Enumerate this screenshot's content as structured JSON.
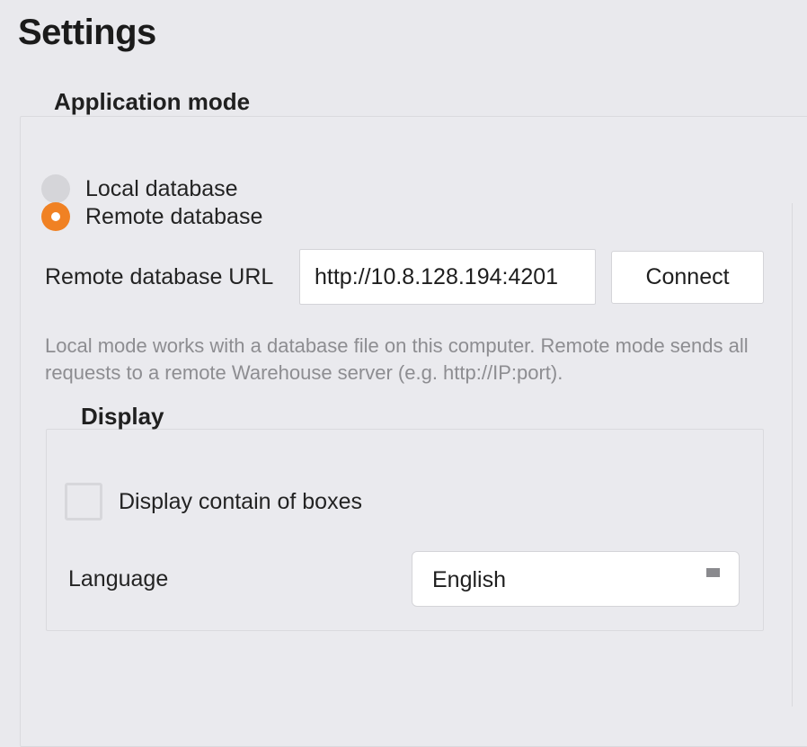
{
  "page": {
    "title": "Settings"
  },
  "application_mode": {
    "group_label": "Application mode",
    "options": [
      {
        "label": "Local database",
        "selected": false
      },
      {
        "label": "Remote database",
        "selected": true
      }
    ],
    "remote_url_label": "Remote database URL",
    "remote_url_value": "http://10.8.128.194:4201",
    "connect_label": "Connect",
    "help_text": "Local mode works with a database file on this computer. Remote mode sends all requests to a remote Warehouse server (e.g. http://IP:port)."
  },
  "display": {
    "group_label": "Display",
    "show_box_contents_label": "Display contain of boxes",
    "show_box_contents_checked": false,
    "language_label": "Language",
    "language_value": "English"
  },
  "colors": {
    "accent": "#f08123",
    "background": "#e9e9ed",
    "help_text": "#8d8d91"
  },
  "icons": {
    "select_arrow": "chevron-down-icon"
  }
}
